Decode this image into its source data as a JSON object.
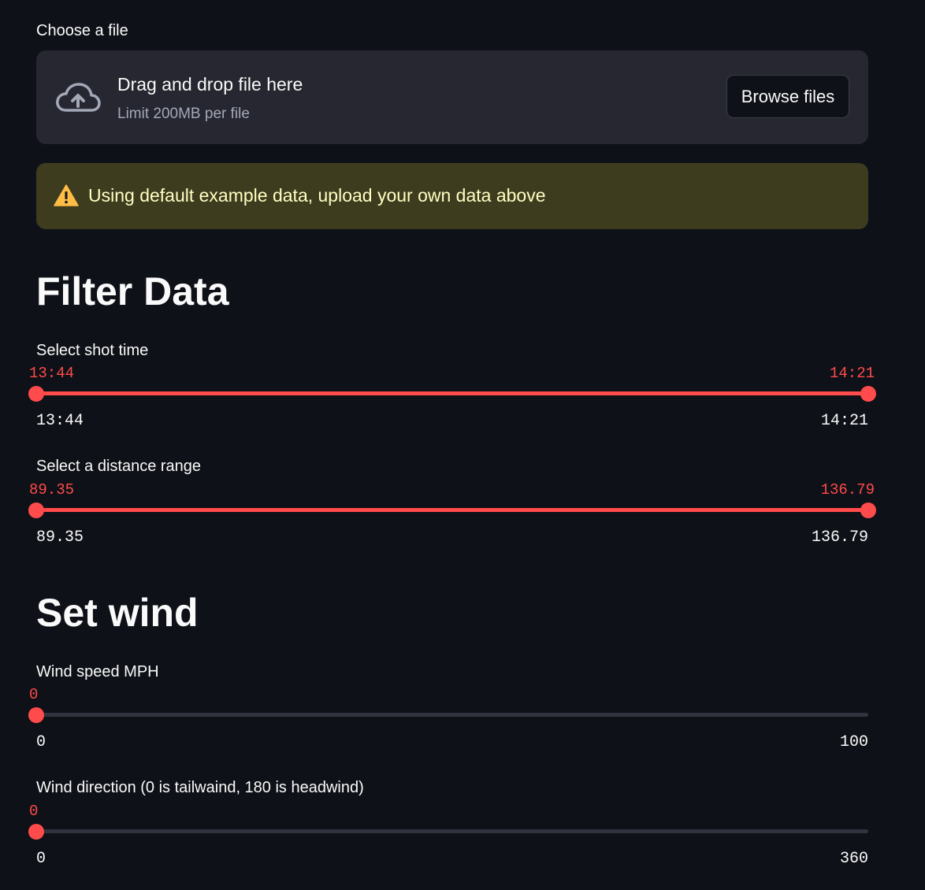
{
  "uploader": {
    "label": "Choose a file",
    "drop_title": "Drag and drop file here",
    "limit": "Limit 200MB per file",
    "browse_label": "Browse files",
    "icon": "cloud-upload-icon"
  },
  "warning": {
    "text": "Using default example data, upload your own data above",
    "icon": "warning-icon"
  },
  "filter": {
    "heading": "Filter Data",
    "shot_time": {
      "label": "Select shot time",
      "value_low": "13:44",
      "value_high": "14:21",
      "min": "13:44",
      "max": "14:21"
    },
    "distance": {
      "label": "Select a distance range",
      "value_low": "89.35",
      "value_high": "136.79",
      "min": "89.35",
      "max": "136.79"
    }
  },
  "wind": {
    "heading": "Set wind",
    "speed": {
      "label": "Wind speed MPH",
      "value": "0",
      "min": "0",
      "max": "100"
    },
    "direction": {
      "label": "Wind direction (0 is tailwaind, 180 is headwind)",
      "value": "0",
      "min": "0",
      "max": "360"
    }
  },
  "colors": {
    "accent": "#ff4b4b",
    "background": "#0e1117",
    "panel": "#262730",
    "warning_bg": "#3e3c1f",
    "warning_text": "#ffffc2",
    "track_inactive": "#31333f"
  }
}
